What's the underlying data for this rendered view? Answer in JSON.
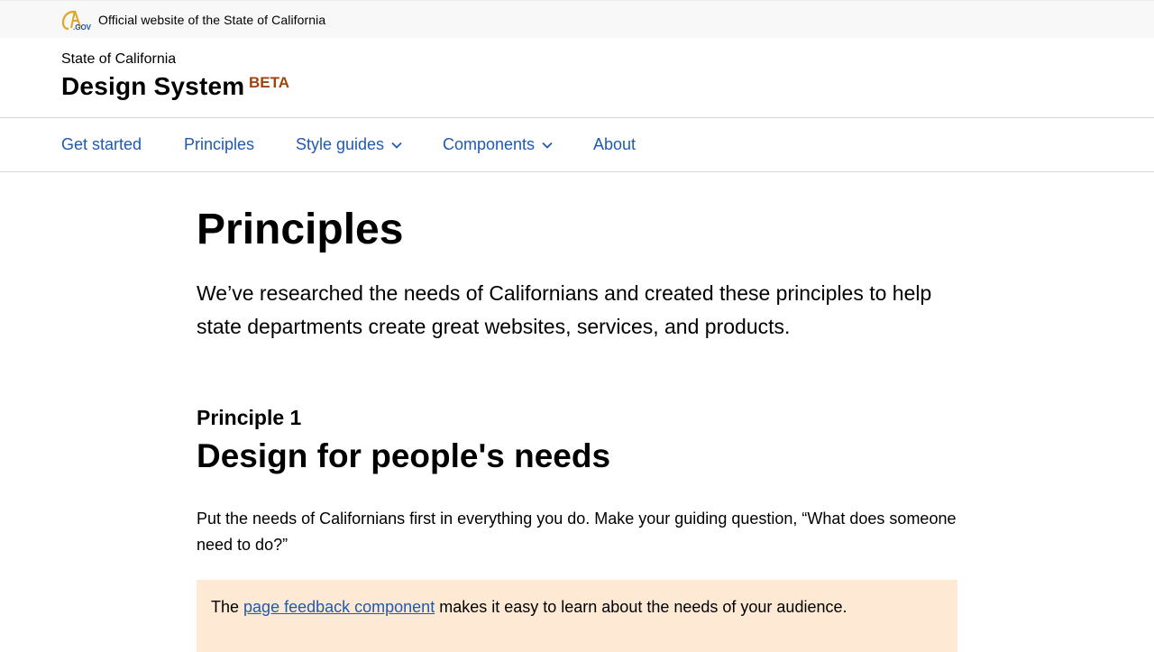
{
  "official_bar": {
    "logo_text": "CA.GOV",
    "text": "Official website of the State of California"
  },
  "header": {
    "org": "State of California",
    "title": "Design System",
    "badge": "BETA"
  },
  "nav": {
    "items": [
      {
        "label": "Get started",
        "has_dropdown": false
      },
      {
        "label": "Principles",
        "has_dropdown": false
      },
      {
        "label": "Style guides",
        "has_dropdown": true
      },
      {
        "label": "Components",
        "has_dropdown": true
      },
      {
        "label": "About",
        "has_dropdown": false
      }
    ]
  },
  "main": {
    "title": "Principles",
    "lead": "We’ve researched the needs of Californians and created these principles to help state departments create great websites, services, and products.",
    "principle": {
      "kicker": "Principle 1",
      "title": "Design for people's needs",
      "body": "Put the needs of Californians first in everything you do. Make your guiding question, “What does someone need to do?”",
      "callout": {
        "before": "The ",
        "link": "page feedback component",
        "after": " makes it easy to learn about the needs of your audience."
      }
    }
  },
  "colors": {
    "link": "#1f5ab0",
    "badge": "#a4420b",
    "callout_bg": "#fde9d4",
    "logo_gold": "#e0a42a",
    "logo_blue": "#1f4e9d"
  },
  "icons": {
    "logo": "ca-gov-logo",
    "dropdown": "chevron-down-icon"
  }
}
